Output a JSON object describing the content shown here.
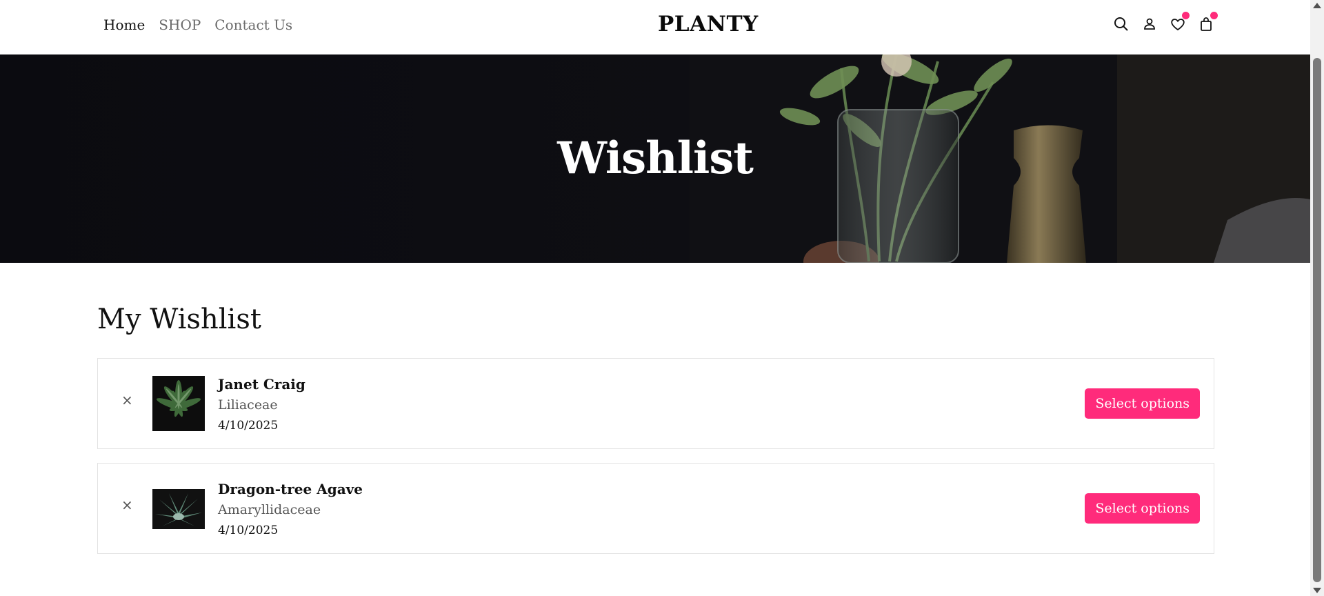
{
  "header": {
    "nav": [
      {
        "label": "Home",
        "active": true
      },
      {
        "label": "SHOP",
        "active": false
      },
      {
        "label": "Contact Us",
        "active": false
      }
    ],
    "logo": "PLANTY",
    "icons": [
      "search-icon",
      "user-icon",
      "heart-icon",
      "bag-icon"
    ],
    "badge_color": "#ff2b7b"
  },
  "hero": {
    "title": "Wishlist"
  },
  "wishlist": {
    "heading": "My Wishlist",
    "remove_symbol": "×",
    "items": [
      {
        "name": "Janet Craig",
        "family": "Liliaceae",
        "date": "4/10/2025",
        "button": "Select options"
      },
      {
        "name": "Dragon-tree Agave",
        "family": "Amaryllidaceae",
        "date": "4/10/2025",
        "button": "Select options"
      }
    ]
  },
  "colors": {
    "accent": "#ff2b7b",
    "hero_bg": "#0e0e13"
  }
}
